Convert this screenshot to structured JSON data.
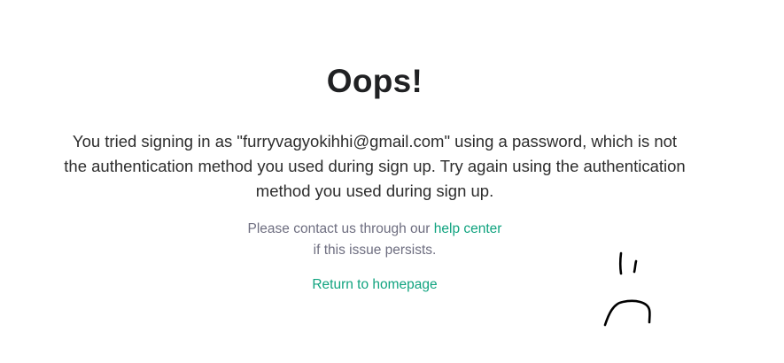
{
  "error": {
    "title": "Oops!",
    "message": "You tried signing in as \"furryvagyokihhi@gmail.com\" using a password, which is not the authentication method you used during sign up. Try again using the authentication method you used during sign up.",
    "contact_prefix": "Please contact us through our ",
    "help_center_link": "help center",
    "contact_suffix": "if this issue persists.",
    "return_link": "Return to homepage"
  },
  "colors": {
    "link": "#10a37f",
    "title": "#202123",
    "muted": "#6e6e80",
    "doodle": "#000000"
  },
  "doodle": {
    "icon": "sad-face-doodle-icon"
  }
}
